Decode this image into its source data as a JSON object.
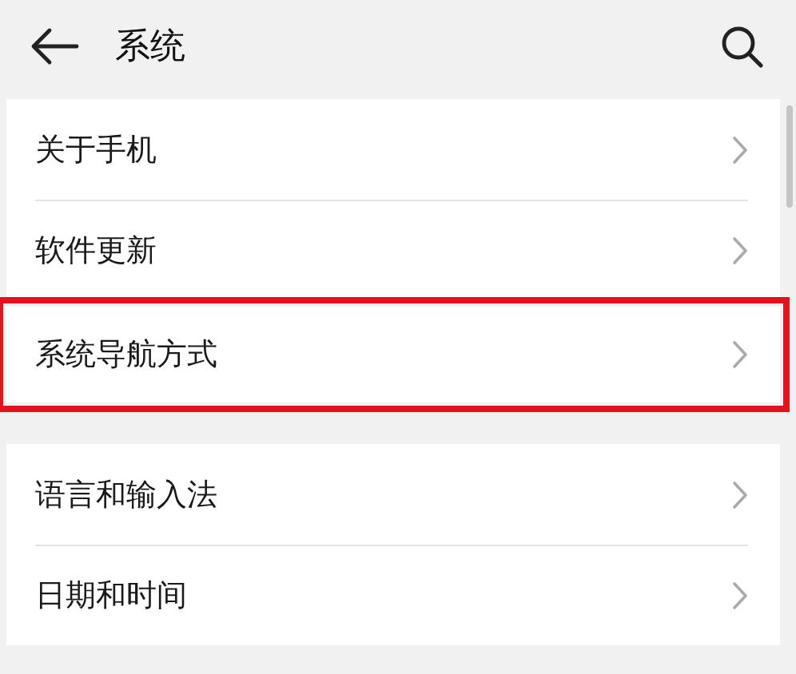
{
  "header": {
    "title": "系统"
  },
  "groups": [
    {
      "items": [
        {
          "label": "关于手机",
          "highlighted": false
        },
        {
          "label": "软件更新",
          "highlighted": false
        }
      ]
    },
    {
      "items": [
        {
          "label": "系统导航方式",
          "highlighted": true
        }
      ]
    },
    {
      "items": [
        {
          "label": "语言和输入法",
          "highlighted": false
        },
        {
          "label": "日期和时间",
          "highlighted": false
        }
      ]
    }
  ]
}
